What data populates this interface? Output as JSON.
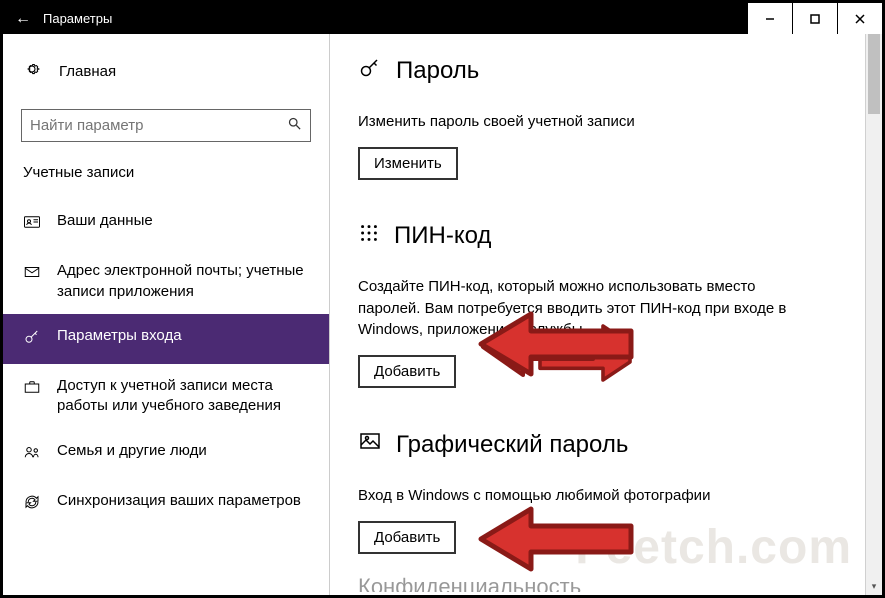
{
  "titlebar": {
    "title": "Параметры"
  },
  "sidebar": {
    "home": "Главная",
    "search_placeholder": "Найти параметр",
    "category": "Учетные записи",
    "items": [
      {
        "label": "Ваши данные"
      },
      {
        "label": "Адрес электронной почты; учетные записи приложения"
      },
      {
        "label": "Параметры входа"
      },
      {
        "label": "Доступ к учетной записи места работы или учебного заведения"
      },
      {
        "label": "Семья и другие люди"
      },
      {
        "label": "Синхронизация ваших параметров"
      }
    ]
  },
  "content": {
    "password": {
      "heading": "Пароль",
      "desc": "Изменить пароль своей учетной записи",
      "button": "Изменить"
    },
    "pin": {
      "heading": "ПИН-код",
      "desc": "Создайте ПИН-код, который можно использовать вместо паролей. Вам потребуется вводить этот ПИН-код при входе в Windows, приложения и службы.",
      "button": "Добавить"
    },
    "picture": {
      "heading": "Графический пароль",
      "desc": "Вход в Windows с помощью любимой фотографии",
      "button": "Добавить"
    },
    "privacy_heading_cutoff": "Конфиденциальность"
  },
  "watermark": "Feetch.com"
}
